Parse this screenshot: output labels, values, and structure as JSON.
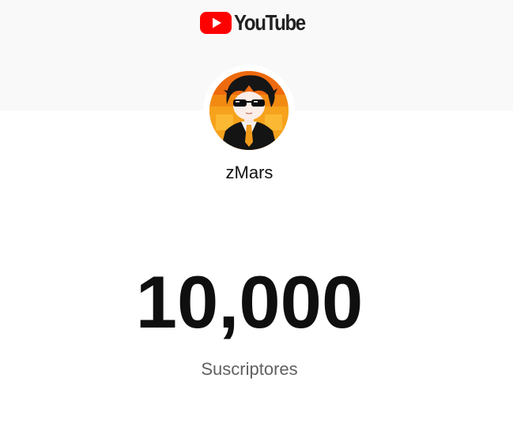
{
  "brand": {
    "logo_text": "YouTube",
    "logo_color": "#ff0000"
  },
  "channel": {
    "name": "zMars",
    "avatar_icon": "anime-character-avatar"
  },
  "stats": {
    "subscriber_count": "10,000",
    "subscriber_label": "Suscriptores"
  },
  "colors": {
    "banner_bg": "#f9f9f9",
    "count_text": "#0f0f0f",
    "label_text": "#606060"
  }
}
